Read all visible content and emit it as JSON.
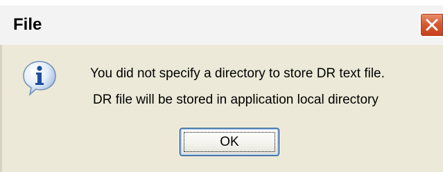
{
  "dialog": {
    "title": "File",
    "icon": "info-icon",
    "message_line_1": "You did not specify a directory to store DR text file.",
    "message_line_2": "DR file will be stored in application local directory",
    "ok_label": "OK"
  },
  "colors": {
    "titlebar": "#f3f3f3",
    "body": "#ece9d8",
    "close_button": "#d65a33",
    "button_border": "#003c74"
  }
}
